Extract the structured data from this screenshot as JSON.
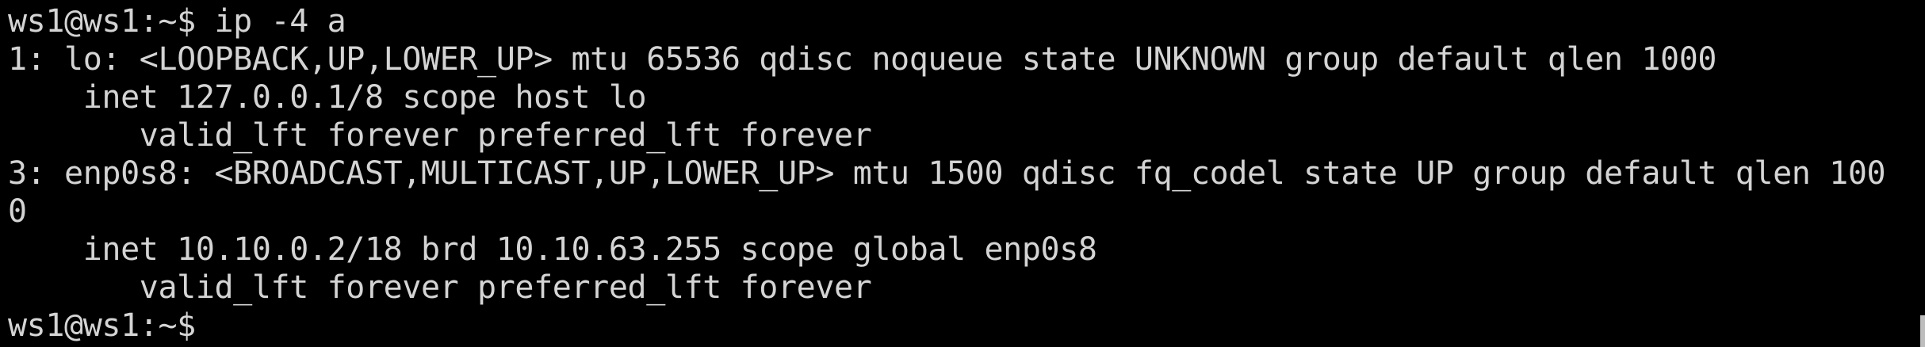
{
  "terminal": {
    "lines": [
      "ws1@ws1:~$ ip -4 a",
      "1: lo: <LOOPBACK,UP,LOWER_UP> mtu 65536 qdisc noqueue state UNKNOWN group default qlen 1000",
      "    inet 127.0.0.1/8 scope host lo",
      "       valid_lft forever preferred_lft forever",
      "3: enp0s8: <BROADCAST,MULTICAST,UP,LOWER_UP> mtu 1500 qdisc fq_codel state UP group default qlen 100",
      "0",
      "    inet 10.10.0.2/18 brd 10.10.63.255 scope global enp0s8",
      "       valid_lft forever preferred_lft forever",
      "ws1@ws1:~$ "
    ],
    "colors": {
      "background": "#000000",
      "foreground": "#d4d4d4"
    }
  }
}
